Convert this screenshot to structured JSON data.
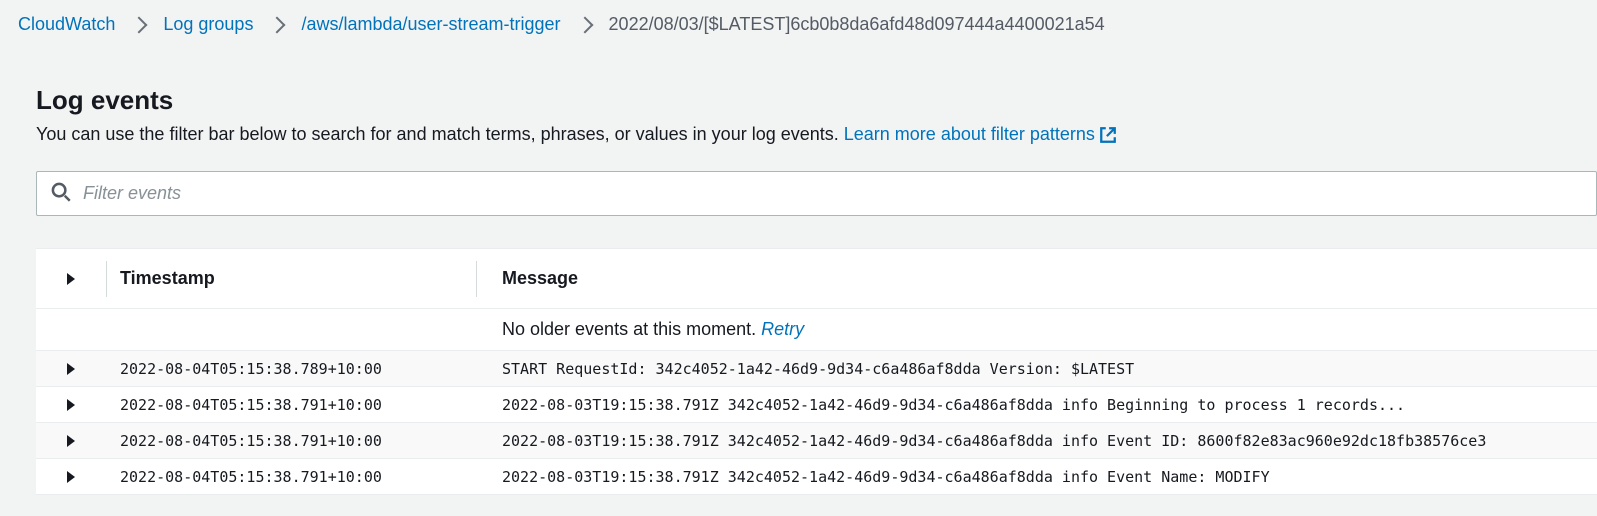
{
  "breadcrumb": {
    "items": [
      {
        "label": "CloudWatch",
        "link": true
      },
      {
        "label": "Log groups",
        "link": true
      },
      {
        "label": "/aws/lambda/user-stream-trigger",
        "link": true
      },
      {
        "label": "2022/08/03/[$LATEST]6cb0b8da6afd48d097444a4400021a54",
        "link": false
      }
    ]
  },
  "header": {
    "title": "Log events",
    "subtitle_prefix": "You can use the filter bar below to search for and match terms, phrases, or values in your log events. ",
    "learn_link": "Learn more about filter patterns"
  },
  "filter": {
    "placeholder": "Filter events",
    "value": ""
  },
  "table": {
    "columns": {
      "timestamp": "Timestamp",
      "message": "Message"
    },
    "info_row": {
      "text": "No older events at this moment. ",
      "retry": "Retry"
    },
    "rows": [
      {
        "timestamp": "2022-08-04T05:15:38.789+10:00",
        "message": "START RequestId: 342c4052-1a42-46d9-9d34-c6a486af8dda Version: $LATEST"
      },
      {
        "timestamp": "2022-08-04T05:15:38.791+10:00",
        "message": "2022-08-03T19:15:38.791Z 342c4052-1a42-46d9-9d34-c6a486af8dda info Beginning to process 1 records..."
      },
      {
        "timestamp": "2022-08-04T05:15:38.791+10:00",
        "message": "2022-08-03T19:15:38.791Z 342c4052-1a42-46d9-9d34-c6a486af8dda info Event ID: 8600f82e83ac960e92dc18fb38576ce3"
      },
      {
        "timestamp": "2022-08-04T05:15:38.791+10:00",
        "message": "2022-08-03T19:15:38.791Z 342c4052-1a42-46d9-9d34-c6a486af8dda info Event Name: MODIFY"
      }
    ]
  }
}
